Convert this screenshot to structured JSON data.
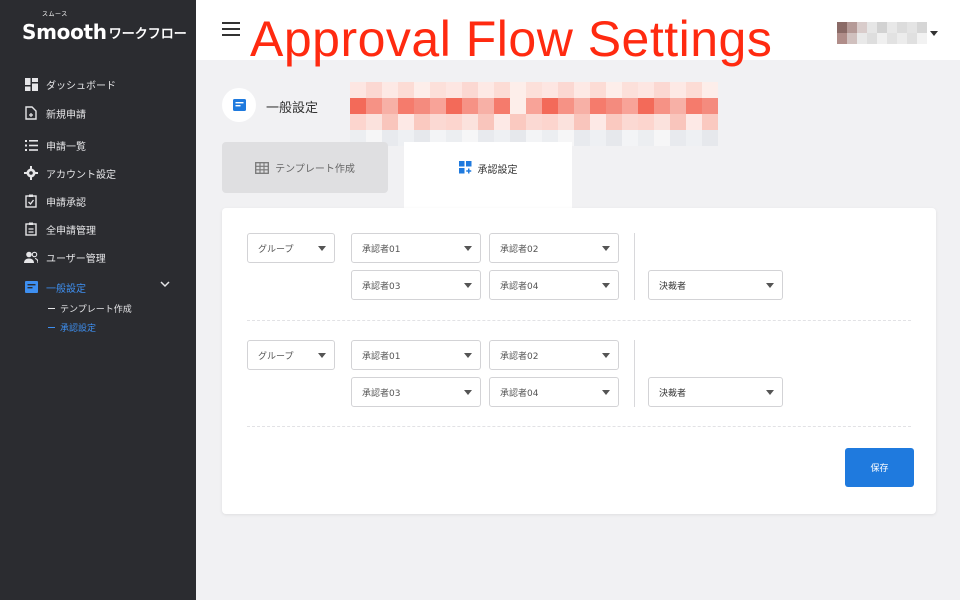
{
  "brand": {
    "name": "Smooth",
    "ruby": "スムース",
    "sub": "ワークフロー"
  },
  "sidebar": {
    "items": [
      {
        "label": "ダッシュボード",
        "icon": "dashboard-icon"
      },
      {
        "label": "新規申請",
        "icon": "new-request-icon"
      },
      {
        "label": "申請一覧",
        "icon": "list-icon"
      },
      {
        "label": "アカウント設定",
        "icon": "gear-icon"
      },
      {
        "label": "申請承認",
        "icon": "approve-check-icon"
      },
      {
        "label": "全申請管理",
        "icon": "clipboard-icon"
      },
      {
        "label": "ユーザー管理",
        "icon": "users-icon"
      },
      {
        "label": "一般設定",
        "icon": "settings-doc-icon"
      }
    ],
    "subitems": [
      {
        "label": "テンプレート作成"
      },
      {
        "label": "承認設定"
      }
    ],
    "active_color": "#3e8ff0"
  },
  "header": {
    "overlay_title": "Approval Flow Settings"
  },
  "page": {
    "title": "一般設定"
  },
  "tabs": [
    {
      "label": "テンプレート作成",
      "icon": "table-grid-icon",
      "active": false
    },
    {
      "label": "承認設定",
      "icon": "approval-grid-icon",
      "active": true
    }
  ],
  "flows": [
    {
      "group": "グループ",
      "approvers": [
        "承認者01",
        "承認者02",
        "承認者03",
        "承認者04"
      ],
      "final": "決裁者"
    },
    {
      "group": "グループ",
      "approvers": [
        "承認者01",
        "承認者02",
        "承認者03",
        "承認者04"
      ],
      "final": "決裁者"
    }
  ],
  "actions": {
    "save_label": "保存"
  },
  "colors": {
    "primary": "#1f7ade",
    "sidebar_bg": "#2b2c30",
    "overlay_title": "#ff2a10"
  }
}
